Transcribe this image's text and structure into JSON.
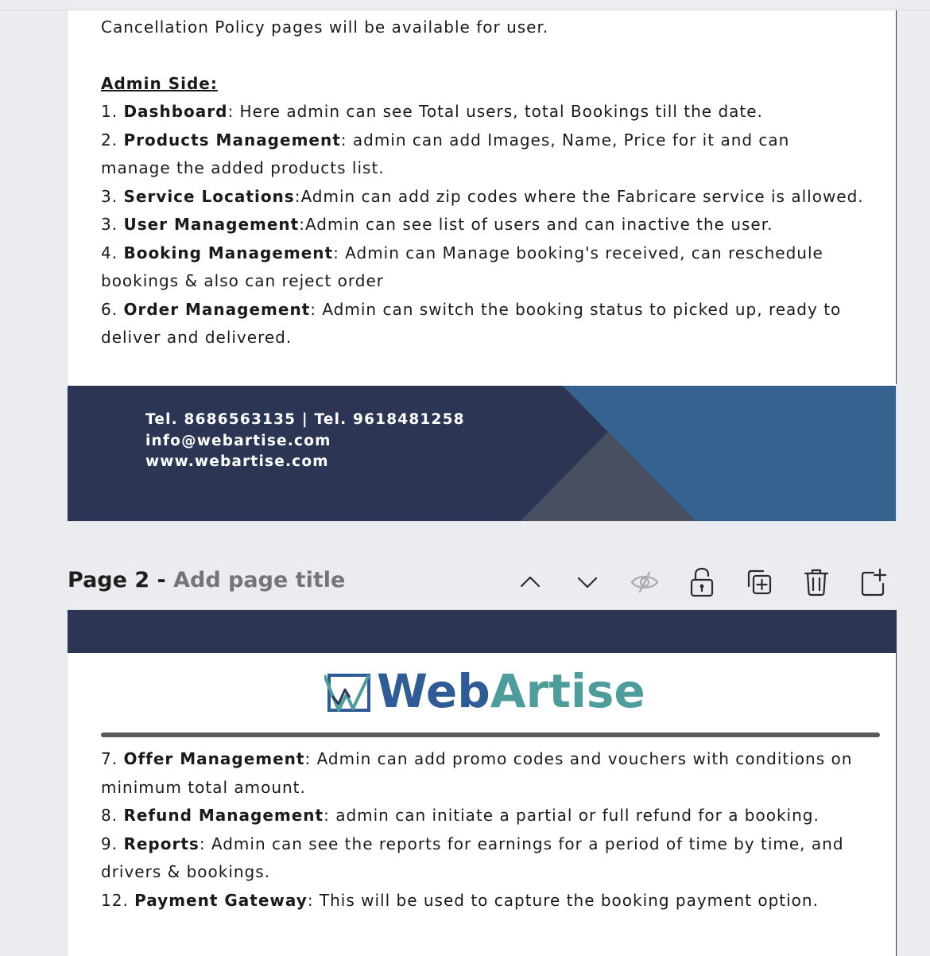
{
  "page1": {
    "intro_line": "Cancellation Policy pages will be available for user.",
    "admin_heading": "Admin Side:",
    "items": [
      {
        "prefix": "1. ",
        "bold": "Dashboard",
        "rest": ": Here admin can see Total users, total Bookings till the date."
      },
      {
        "prefix": "2. ",
        "bold": "Products Management",
        "rest": ": admin can add Images, Name, Price for it and can manage the added products list."
      },
      {
        "prefix": "3. ",
        "bold": "Service Locations",
        "rest": ":Admin can add zip codes where the Fabricare service is allowed."
      },
      {
        "prefix": "3. ",
        "bold": "User Management",
        "rest": ":Admin can see list of users and can inactive the user."
      },
      {
        "prefix": "4. ",
        "bold": "Booking Management",
        "rest": ": Admin can Manage booking's received, can reschedule bookings & also can reject order"
      },
      {
        "prefix": "6. ",
        "bold": "Order Management",
        "rest": ": Admin can switch the booking status to picked up, ready to deliver and delivered."
      }
    ],
    "footer": {
      "phones": "Tel. 8686563135 | Tel. 9618481258",
      "email": "info@webartise.com",
      "website": "www.webartise.com"
    }
  },
  "page_bar": {
    "page_label": "Page 2 - ",
    "title_placeholder": "Add page title"
  },
  "toolbar_icons": [
    "chevron-up-icon",
    "chevron-down-icon",
    "eye-hidden-icon",
    "lock-open-icon",
    "duplicate-icon",
    "trash-icon",
    "add-page-icon"
  ],
  "page2": {
    "logo": {
      "part1": "Web",
      "part2": "Artise"
    },
    "items": [
      {
        "prefix": "7. ",
        "bold": "Offer Management",
        "rest": ": Admin can add promo codes and vouchers with conditions on minimum total amount."
      },
      {
        "prefix": "8. ",
        "bold": "Refund Management",
        "rest": ": admin can initiate a partial or full refund for a booking."
      },
      {
        "prefix": "9. ",
        "bold": "Reports",
        "rest": ": Admin can see the reports for earnings for a period of time by time, and drivers & bookings."
      },
      {
        "prefix": "12. ",
        "bold": "Payment Gateway",
        "rest": ": This will be used to capture the booking payment option."
      }
    ]
  },
  "colors": {
    "navy": "#2c3654",
    "blue": "#36628f",
    "slate": "#484f60",
    "logo_blue": "#2f5c97",
    "logo_teal": "#4c9d9b"
  }
}
